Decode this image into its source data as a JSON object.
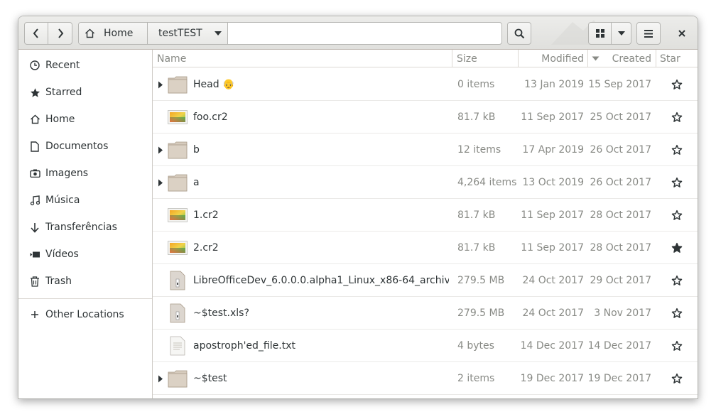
{
  "toolbar": {
    "back_icon": "go-previous-icon",
    "forward_icon": "go-next-icon",
    "search_icon": "search-icon",
    "view_icon": "grid-view-icon",
    "menu_icon": "hamburger-menu-icon",
    "close_icon": "close-icon"
  },
  "pathbar": {
    "home_label": "Home",
    "current_label": "testTEST"
  },
  "sidebar": {
    "items": [
      {
        "label": "Recent",
        "icon": "clock-icon"
      },
      {
        "label": "Starred",
        "icon": "star-icon"
      },
      {
        "label": "Home",
        "icon": "home-icon"
      },
      {
        "label": "Documentos",
        "icon": "document-icon"
      },
      {
        "label": "Imagens",
        "icon": "camera-icon"
      },
      {
        "label": "Música",
        "icon": "music-icon"
      },
      {
        "label": "Transferências",
        "icon": "download-arrow-icon"
      },
      {
        "label": "Vídeos",
        "icon": "video-icon"
      },
      {
        "label": "Trash",
        "icon": "trash-icon"
      }
    ],
    "other_locations": {
      "label": "Other Locations",
      "icon": "plus-icon"
    }
  },
  "columns": {
    "name": "Name",
    "size": "Size",
    "modified": "Modified",
    "created": "Created",
    "star": "Star"
  },
  "files": [
    {
      "name": "Head 👴",
      "type": "folder",
      "expandable": true,
      "size": "0 items",
      "modified": "13 Jan 2019",
      "created": "15 Sep 2017",
      "starred": false
    },
    {
      "name": "foo.cr2",
      "type": "image",
      "expandable": false,
      "size": "81.7 kB",
      "modified": "11 Sep 2017",
      "created": "25 Oct 2017",
      "starred": false
    },
    {
      "name": "b",
      "type": "folder",
      "expandable": true,
      "size": "12 items",
      "modified": "17 Apr 2019",
      "created": "26 Oct 2017",
      "starred": false
    },
    {
      "name": "a",
      "type": "folder",
      "expandable": true,
      "size": "4,264 items",
      "modified": "13 Oct 2019",
      "created": "26 Oct 2017",
      "starred": false
    },
    {
      "name": "1.cr2",
      "type": "image",
      "expandable": false,
      "size": "81.7 kB",
      "modified": "11 Sep 2017",
      "created": "28 Oct 2017",
      "starred": false
    },
    {
      "name": "2.cr2",
      "type": "image",
      "expandable": false,
      "size": "81.7 kB",
      "modified": "11 Sep 2017",
      "created": "28 Oct 2017",
      "starred": true
    },
    {
      "name": "LibreOfficeDev_6.0.0.0.alpha1_Linux_x86-64_archiv…",
      "type": "archive",
      "expandable": false,
      "size": "279.5 MB",
      "modified": "24 Oct 2017",
      "created": "29 Oct 2017",
      "starred": false
    },
    {
      "name": "~$test.xls?",
      "type": "archive",
      "expandable": false,
      "size": "279.5 MB",
      "modified": "24 Oct 2017",
      "created": "3 Nov 2017",
      "starred": false
    },
    {
      "name": "apostroph'ed_file.txt",
      "type": "text",
      "expandable": false,
      "size": "4 bytes",
      "modified": "14 Dec 2017",
      "created": "14 Dec 2017",
      "starred": false
    },
    {
      "name": "~$test",
      "type": "folder",
      "expandable": true,
      "size": "2 items",
      "modified": "19 Dec 2017",
      "created": "19 Dec 2017",
      "starred": false
    }
  ],
  "colors": {
    "folder": "#d6cbbd",
    "text_secondary": "#888a85",
    "text_primary": "#2e3436"
  }
}
